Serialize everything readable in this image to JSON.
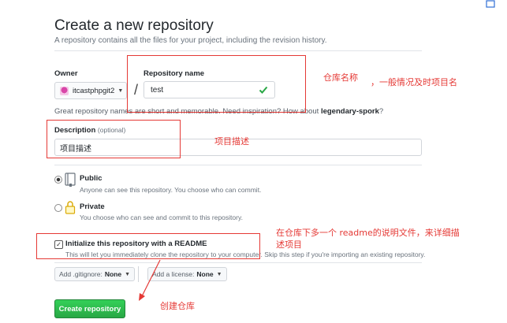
{
  "header": {
    "title": "Create a new repository",
    "subtitle": "A repository contains all the files for your project, including the revision history."
  },
  "owner": {
    "label": "Owner",
    "value": "itcastphpgit2"
  },
  "repo_name": {
    "label": "Repository name",
    "value": "test",
    "separator": "/"
  },
  "hint": {
    "prefix": "Great repository names are short and memorable. Need inspiration? How about ",
    "suggestion": "legendary-spork",
    "suffix": "?"
  },
  "description": {
    "label": "Description",
    "optional": "(optional)",
    "value": "项目描述"
  },
  "visibility": {
    "public": {
      "title": "Public",
      "desc": "Anyone can see this repository. You choose who can commit.",
      "selected": true
    },
    "private": {
      "title": "Private",
      "desc": "You choose who can see and commit to this repository.",
      "selected": false
    }
  },
  "readme": {
    "label": "Initialize this repository with a README",
    "desc": "This will let you immediately clone the repository to your computer. Skip this step if you're importing an existing repository.",
    "checked": true
  },
  "gitignore": {
    "label": "Add .gitignore:",
    "value": "None"
  },
  "license": {
    "label": "Add a license:",
    "value": "None"
  },
  "submit": {
    "label": "Create repository"
  },
  "annotations": {
    "repo_name_note_a": "仓库名称",
    "repo_name_note_b": "，一般情况及时项目名",
    "description_note": "项目描述",
    "readme_note_line1": "在仓库下多一个  readme的说明文件，来详细描",
    "readme_note_line2": "述项目",
    "create_note": "创建仓库"
  },
  "colors": {
    "annotation": "#e53935",
    "primary_button": "#28a745",
    "valid_check": "#28a745"
  }
}
